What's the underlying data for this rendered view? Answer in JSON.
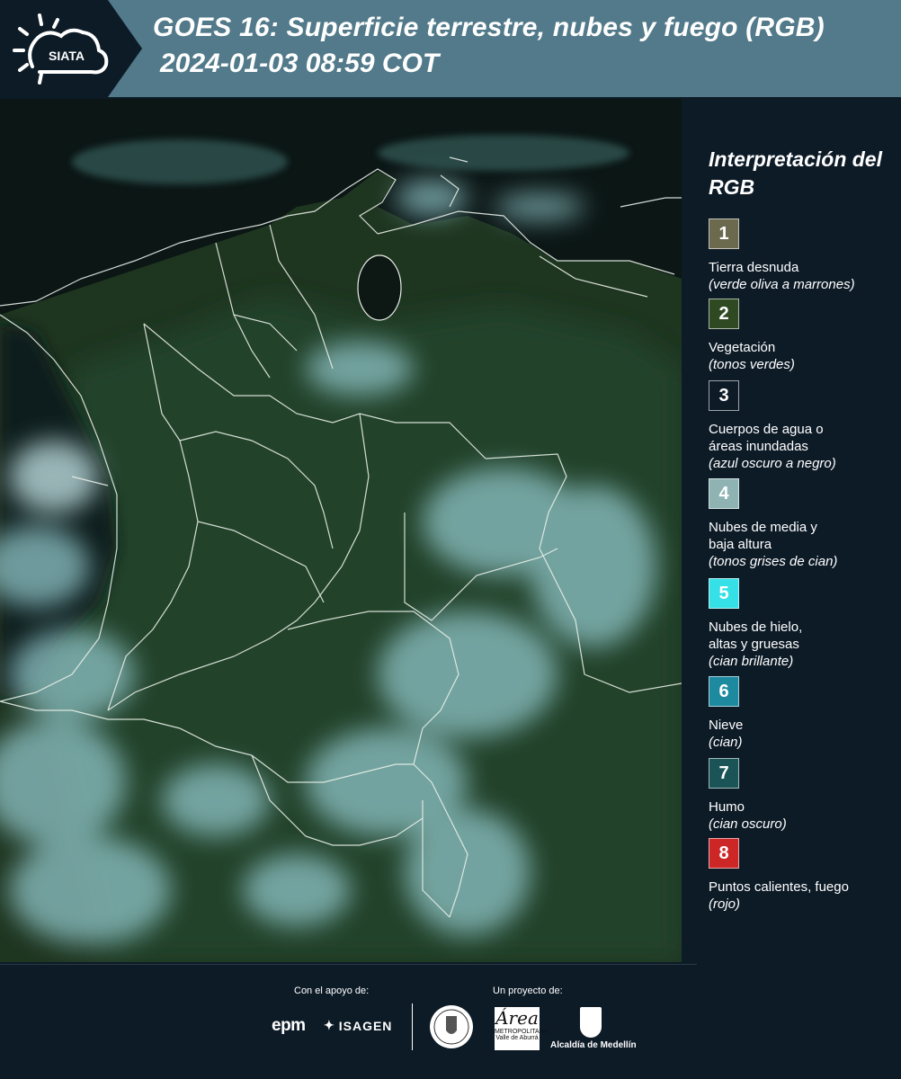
{
  "header": {
    "logo_text": "SIATA",
    "title_line1": "GOES 16: Superficie terrestre, nubes y fuego (RGB)",
    "title_line2": "2024-01-03 08:59 COT",
    "bar_color": "#527a8a"
  },
  "legend": {
    "title": "Interpretación del RGB",
    "items": [
      {
        "number": "1",
        "label": "Tierra desnuda",
        "desc": "(verde oliva a marrones)",
        "color": "#6b6a4e"
      },
      {
        "number": "2",
        "label": "Vegetación",
        "desc": "(tonos verdes)",
        "color": "#2f4a22"
      },
      {
        "number": "3",
        "label": "Cuerpos de agua o áreas inundadas",
        "desc": "(azul oscuro a negro)",
        "color": "#0d1b27"
      },
      {
        "number": "4",
        "label": "Nubes de media y baja altura",
        "desc": "(tonos grises de cian)",
        "color": "#8fb3b3"
      },
      {
        "number": "5",
        "label": "Nubes de hielo, altas y gruesas",
        "desc": "(cian brillante)",
        "color": "#35e0e6"
      },
      {
        "number": "6",
        "label": "Nieve",
        "desc": "(cian)",
        "color": "#1e8aa0"
      },
      {
        "number": "7",
        "label": "Humo",
        "desc": "(cian oscuro)",
        "color": "#1b5456"
      },
      {
        "number": "8",
        "label": "Puntos calientes, fuego",
        "desc": "(rojo)",
        "color": "#cc2626"
      }
    ]
  },
  "footer": {
    "support_label": "Con el apoyo de:",
    "project_label": "Un proyecto de:",
    "sponsor1": "epm",
    "sponsor2": "ISAGEN",
    "partner1": "Área",
    "partner1_sub": "METROPOLITANA",
    "partner1_sub2": "Valle de Aburrá",
    "partner2": "Alcaldía de Medellín"
  }
}
